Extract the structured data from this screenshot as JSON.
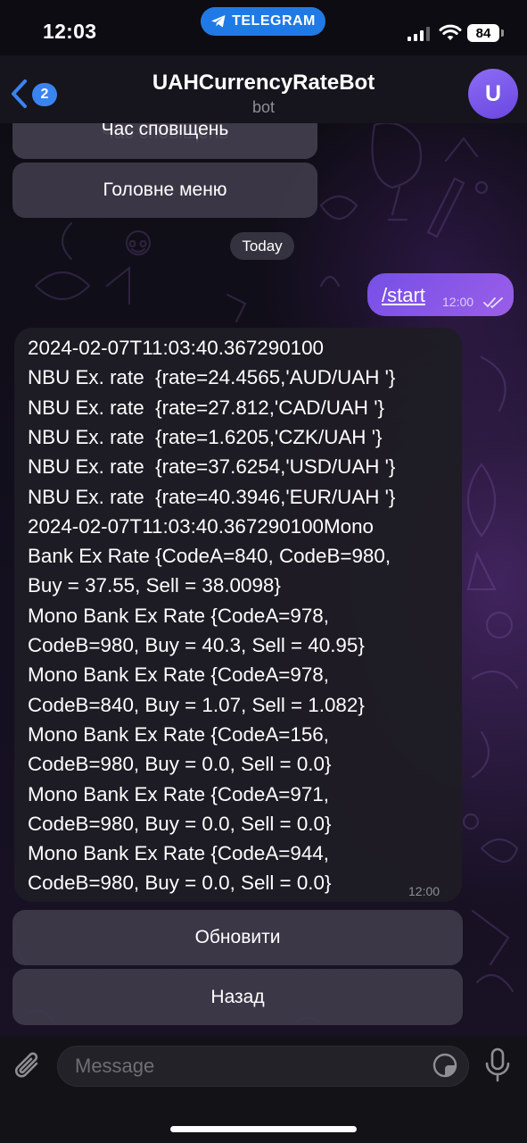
{
  "status_bar": {
    "time": "12:03",
    "telegram_pill": "TELEGRAM",
    "battery": "84"
  },
  "header": {
    "back_badge": "2",
    "title": "UAHCurrencyRateBot",
    "subtitle": "bot",
    "avatar_letter": "U"
  },
  "top_keyboard": [
    "Час сповіщень",
    "Головне меню"
  ],
  "date_separator": "Today",
  "outgoing": {
    "text": "/start",
    "time": "12:00",
    "status": "read"
  },
  "incoming": {
    "lines": [
      "2024-02-07T11:03:40.367290100",
      "NBU Ex. rate  {rate=24.4565,'AUD/UAH '}",
      "NBU Ex. rate  {rate=27.812,'CAD/UAH '}",
      "NBU Ex. rate  {rate=1.6205,'CZK/UAH '}",
      "NBU Ex. rate  {rate=37.6254,'USD/UAH '}",
      "NBU Ex. rate  {rate=40.3946,'EUR/UAH '}",
      "2024-02-07T11:03:40.367290100Mono",
      "Bank Ex Rate {CodeA=840, CodeB=980,",
      "Buy = 37.55, Sell = 38.0098}",
      "Mono Bank Ex Rate {CodeA=978,",
      "CodeB=980, Buy = 40.3, Sell = 40.95}",
      "Mono Bank Ex Rate {CodeA=978,",
      "CodeB=840, Buy = 1.07, Sell = 1.082}",
      "Mono Bank Ex Rate {CodeA=156,",
      "CodeB=980, Buy = 0.0, Sell = 0.0}",
      "Mono Bank Ex Rate {CodeA=971,",
      "CodeB=980, Buy = 0.0, Sell = 0.0}",
      "Mono Bank Ex Rate {CodeA=944,",
      "CodeB=980, Buy = 0.0, Sell = 0.0}"
    ],
    "time": "12:00"
  },
  "bottom_keyboard": [
    "Обновити",
    "Назад"
  ],
  "composer": {
    "placeholder": "Message"
  },
  "icons": {
    "back": "chevron-left-icon",
    "attach": "paperclip-icon",
    "sticker": "sticker-icon",
    "mic": "microphone-icon",
    "check": "double-check-icon",
    "telegram": "telegram-plane-icon"
  },
  "colors": {
    "accent": "#3a84f0",
    "outgoing_bubble": "#8758e8",
    "telegram_pill": "#1f7ae6",
    "avatar": "#7a5aee"
  }
}
